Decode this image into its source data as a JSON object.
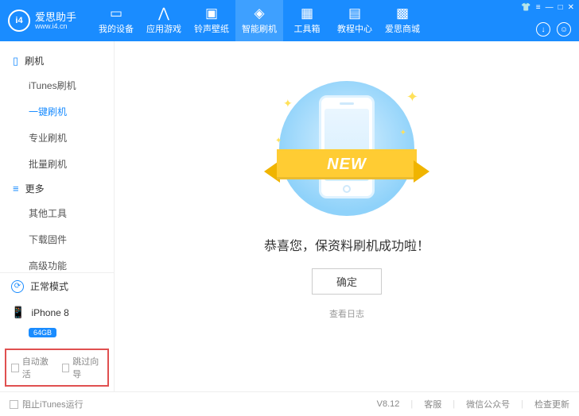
{
  "brand": {
    "name": "爱思助手",
    "url": "www.i4.cn",
    "logo_text": "i4"
  },
  "nav": [
    {
      "label": "我的设备"
    },
    {
      "label": "应用游戏"
    },
    {
      "label": "铃声壁纸"
    },
    {
      "label": "智能刷机"
    },
    {
      "label": "工具箱"
    },
    {
      "label": "教程中心"
    },
    {
      "label": "爱思商城"
    }
  ],
  "nav_active_index": 3,
  "sidebar": {
    "group1": {
      "title": "刷机",
      "items": [
        "iTunes刷机",
        "一键刷机",
        "专业刷机",
        "批量刷机"
      ],
      "active_index": 1
    },
    "group2": {
      "title": "更多",
      "items": [
        "其他工具",
        "下载固件",
        "高级功能"
      ]
    },
    "mode_label": "正常模式",
    "device_name": "iPhone 8",
    "device_storage": "64GB",
    "check_auto_activate": "自动激活",
    "check_skip_wizard": "跳过向导"
  },
  "main": {
    "ribbon_text": "NEW",
    "success_text": "恭喜您，保资料刷机成功啦！",
    "ok_button": "确定",
    "view_log": "查看日志"
  },
  "statusbar": {
    "block_itunes": "阻止iTunes运行",
    "version": "V8.12",
    "support": "客服",
    "wechat": "微信公众号",
    "check_update": "检查更新"
  }
}
